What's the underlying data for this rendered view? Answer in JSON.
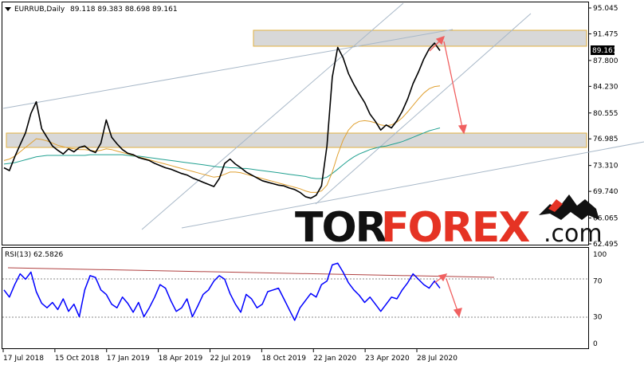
{
  "header": {
    "symbol": "EURRUB,Daily",
    "ohlc": "89.118 89.383 88.698 89.161"
  },
  "price_label": "89.161",
  "rsi_header": "RSI(13) 62.5826",
  "logo": {
    "part1": "TOR",
    "part2": "FOREX",
    "part3": ".com"
  },
  "colors": {
    "price": "#000000",
    "ma_fast": "#e0a030",
    "ma_slow": "#20a090",
    "rsi": "#0000ff",
    "arrow": "#f06060",
    "zone_fill": "#d8d8d8",
    "zone_border": "#e0b040",
    "trendline": "#a8b8c8",
    "rsi_trendline": "#b04040",
    "logo_accent": "#e53324"
  },
  "chart_data": [
    {
      "type": "line",
      "title": "EURRUB,Daily",
      "x_tick_labels": [
        "17 Jul 2018",
        "15 Oct 2018",
        "17 Jan 2019",
        "18 Apr 2019",
        "22 Jul 2019",
        "18 Oct 2019",
        "22 Jan 2020",
        "23 Apr 2020",
        "28 Jul 2020"
      ],
      "y_tick_labels": [
        "95.045",
        "91.475",
        "87.800",
        "84.230",
        "80.555",
        "76.985",
        "73.310",
        "69.740",
        "66.065",
        "62.495"
      ],
      "ylim": [
        62.495,
        95.045
      ],
      "grid": false,
      "series": [
        {
          "values": [
            73.0,
            72.6,
            74.5,
            76.2,
            77.8,
            80.5,
            82.1,
            78.4,
            77.2,
            76.0,
            75.4,
            74.9,
            75.6,
            75.2,
            75.8,
            76.0,
            75.4,
            75.1,
            76.4,
            79.6,
            77.2,
            76.3,
            75.5,
            75.0,
            74.8,
            74.4,
            74.2,
            74.0,
            73.6,
            73.3,
            73.0,
            72.8,
            72.5,
            72.2,
            72.0,
            71.6,
            71.3,
            71.0,
            70.7,
            70.4,
            71.5,
            73.6,
            74.2,
            73.5,
            73.0,
            72.4,
            72.0,
            71.6,
            71.2,
            71.0,
            70.8,
            70.6,
            70.5,
            70.2,
            70.0,
            69.6,
            69.0,
            68.8,
            69.2,
            70.5,
            76.0,
            85.5,
            89.6,
            88.2,
            86.0,
            84.5,
            83.2,
            82.0,
            80.4,
            79.4,
            78.2,
            78.9,
            78.5,
            79.5,
            80.8,
            82.5,
            84.6,
            86.2,
            88.0,
            89.4,
            90.2,
            89.161
          ]
        },
        {
          "values": [
            74.0,
            74.2,
            74.6,
            75.2,
            75.8,
            76.4,
            77.0,
            76.9,
            76.7,
            76.4,
            76.1,
            75.9,
            75.7,
            75.6,
            75.5,
            75.5,
            75.4,
            75.3,
            75.4,
            75.6,
            75.5,
            75.3,
            75.1,
            74.9,
            74.7,
            74.5,
            74.3,
            74.1,
            73.9,
            73.7,
            73.5,
            73.3,
            73.1,
            72.9,
            72.7,
            72.5,
            72.3,
            72.1,
            71.9,
            71.7,
            71.8,
            72.1,
            72.4,
            72.4,
            72.3,
            72.1,
            71.9,
            71.7,
            71.5,
            71.3,
            71.1,
            70.9,
            70.7,
            70.5,
            70.3,
            70.1,
            69.8,
            69.6,
            69.6,
            69.8,
            70.6,
            72.4,
            74.8,
            76.8,
            78.2,
            79.0,
            79.4,
            79.5,
            79.4,
            79.2,
            78.9,
            78.8,
            78.9,
            79.3,
            79.9,
            80.7,
            81.6,
            82.5,
            83.3,
            83.9,
            84.2,
            84.3
          ]
        },
        {
          "values": [
            73.5,
            73.6,
            73.7,
            73.9,
            74.1,
            74.3,
            74.5,
            74.6,
            74.7,
            74.7,
            74.7,
            74.7,
            74.7,
            74.7,
            74.7,
            74.7,
            74.8,
            74.8,
            74.8,
            74.8,
            74.8,
            74.8,
            74.8,
            74.7,
            74.6,
            74.6,
            74.5,
            74.4,
            74.3,
            74.2,
            74.1,
            74.0,
            73.9,
            73.8,
            73.7,
            73.6,
            73.5,
            73.4,
            73.3,
            73.2,
            73.1,
            73.1,
            73.0,
            73.0,
            72.9,
            72.9,
            72.8,
            72.7,
            72.6,
            72.5,
            72.4,
            72.3,
            72.2,
            72.1,
            72.0,
            71.9,
            71.8,
            71.6,
            71.5,
            71.5,
            71.7,
            72.2,
            72.8,
            73.4,
            74.0,
            74.5,
            74.9,
            75.2,
            75.5,
            75.7,
            75.9,
            76.0,
            76.2,
            76.4,
            76.6,
            76.9,
            77.2,
            77.5,
            77.8,
            78.1,
            78.3,
            78.5
          ]
        }
      ]
    },
    {
      "type": "line",
      "title": "RSI(13) 62.5826",
      "y_tick_labels": [
        "100",
        "70",
        "30",
        "0"
      ],
      "ylim": [
        0,
        100
      ],
      "series": [
        {
          "values": [
            60,
            52,
            66,
            78,
            72,
            80,
            58,
            45,
            40,
            46,
            38,
            50,
            36,
            44,
            30,
            60,
            76,
            74,
            60,
            55,
            44,
            40,
            52,
            45,
            35,
            46,
            30,
            40,
            52,
            66,
            62,
            48,
            36,
            40,
            50,
            30,
            42,
            55,
            60,
            70,
            76,
            72,
            56,
            44,
            35,
            55,
            50,
            40,
            44,
            58,
            60,
            62,
            50,
            38,
            26,
            40,
            48,
            56,
            52,
            66,
            70,
            88,
            90,
            80,
            68,
            60,
            54,
            46,
            52,
            44,
            36,
            44,
            52,
            50,
            60,
            68,
            78,
            72,
            66,
            62,
            70,
            62
          ]
        }
      ]
    }
  ]
}
